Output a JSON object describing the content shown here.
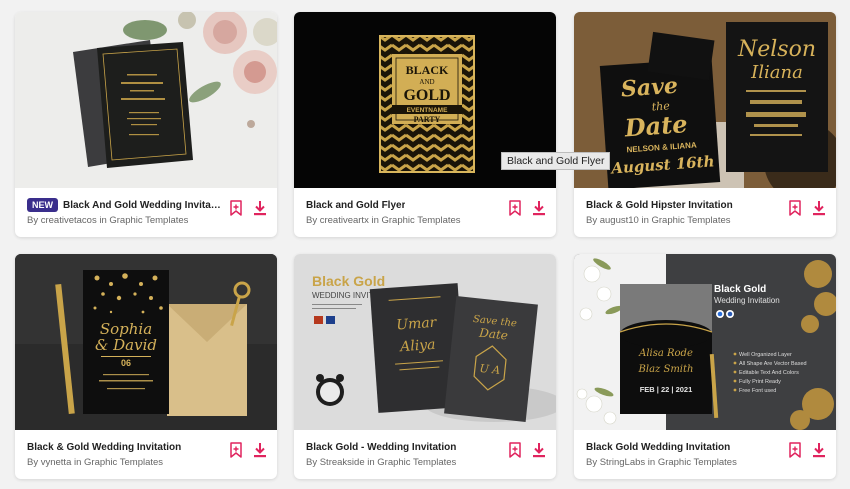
{
  "colors": {
    "accent": "#e0245e",
    "badge": "#3a2e8c",
    "gold": "#c9a449"
  },
  "icons": {
    "bookmark": "bookmark-plus-icon",
    "download": "download-icon"
  },
  "tooltip": "Black and Gold Flyer",
  "cards": [
    {
      "badge": "NEW",
      "title": "Black And Gold Wedding Invitati...",
      "byline": "By creativetacos in Graphic Templates"
    },
    {
      "title": "Black and Gold Flyer",
      "byline": "By creativeartx in Graphic Templates",
      "thumb": {
        "line1": "BLACK",
        "line2": "AND",
        "line3": "GOLD",
        "line4": "EVENTNAME",
        "line5": "PARTY"
      }
    },
    {
      "title": "Black & Gold Hipster Invitation",
      "byline": "By august10 in Graphic Templates",
      "thumb": {
        "line1": "Save",
        "line2": "the",
        "line3": "Date",
        "line4": "NELSON & ILIANA",
        "line5": "August 16th",
        "right1": "Nelson",
        "right2": "Iliana"
      }
    },
    {
      "title": "Black & Gold Wedding Invitation",
      "byline": "By vynetta in Graphic Templates",
      "thumb": {
        "line1": "Sophia",
        "line2": "& David",
        "line3": "06"
      }
    },
    {
      "title": "Black Gold - Wedding Invitation",
      "byline": "By Streakside in Graphic Templates",
      "thumb": {
        "heading": "Black Gold",
        "sub": "WEDDING INVITATION",
        "names1": "Umar",
        "names2": "Aliya",
        "save1": "Save the",
        "save2": "Date",
        "mono": "U A"
      }
    },
    {
      "title": "Black Gold Wedding Invitation",
      "byline": "By StringLabs in Graphic Templates",
      "thumb": {
        "heading": "Black Gold",
        "sub": "Wedding Invitation",
        "features": [
          "Well Organized Layer",
          "All Shape Are Vector Based",
          "Editable Text And Colors",
          "Fully Print Ready",
          "Free Font used"
        ],
        "names1": "Alisa Rode",
        "names2": "Blaz Smith",
        "date": "FEB | 22 | 2021"
      }
    }
  ]
}
